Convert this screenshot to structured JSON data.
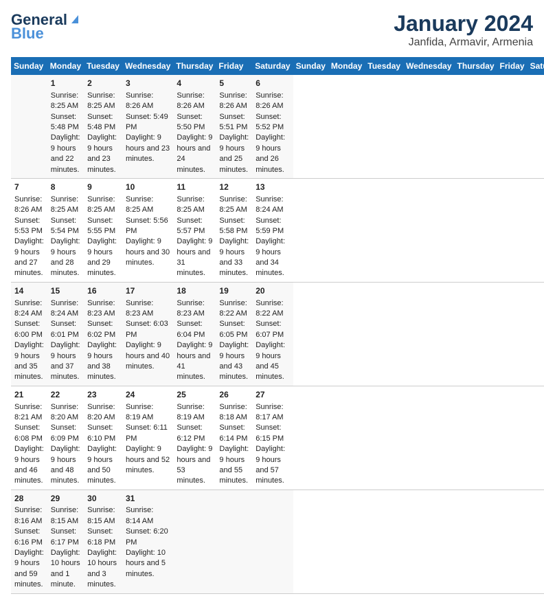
{
  "header": {
    "logo_general": "General",
    "logo_blue": "Blue",
    "title": "January 2024",
    "subtitle": "Janfida, Armavir, Armenia"
  },
  "calendar": {
    "days_of_week": [
      "Sunday",
      "Monday",
      "Tuesday",
      "Wednesday",
      "Thursday",
      "Friday",
      "Saturday"
    ],
    "weeks": [
      [
        {
          "day": "",
          "sunrise": "",
          "sunset": "",
          "daylight": ""
        },
        {
          "day": "1",
          "sunrise": "Sunrise: 8:25 AM",
          "sunset": "Sunset: 5:48 PM",
          "daylight": "Daylight: 9 hours and 22 minutes."
        },
        {
          "day": "2",
          "sunrise": "Sunrise: 8:25 AM",
          "sunset": "Sunset: 5:48 PM",
          "daylight": "Daylight: 9 hours and 23 minutes."
        },
        {
          "day": "3",
          "sunrise": "Sunrise: 8:26 AM",
          "sunset": "Sunset: 5:49 PM",
          "daylight": "Daylight: 9 hours and 23 minutes."
        },
        {
          "day": "4",
          "sunrise": "Sunrise: 8:26 AM",
          "sunset": "Sunset: 5:50 PM",
          "daylight": "Daylight: 9 hours and 24 minutes."
        },
        {
          "day": "5",
          "sunrise": "Sunrise: 8:26 AM",
          "sunset": "Sunset: 5:51 PM",
          "daylight": "Daylight: 9 hours and 25 minutes."
        },
        {
          "day": "6",
          "sunrise": "Sunrise: 8:26 AM",
          "sunset": "Sunset: 5:52 PM",
          "daylight": "Daylight: 9 hours and 26 minutes."
        }
      ],
      [
        {
          "day": "7",
          "sunrise": "Sunrise: 8:26 AM",
          "sunset": "Sunset: 5:53 PM",
          "daylight": "Daylight: 9 hours and 27 minutes."
        },
        {
          "day": "8",
          "sunrise": "Sunrise: 8:25 AM",
          "sunset": "Sunset: 5:54 PM",
          "daylight": "Daylight: 9 hours and 28 minutes."
        },
        {
          "day": "9",
          "sunrise": "Sunrise: 8:25 AM",
          "sunset": "Sunset: 5:55 PM",
          "daylight": "Daylight: 9 hours and 29 minutes."
        },
        {
          "day": "10",
          "sunrise": "Sunrise: 8:25 AM",
          "sunset": "Sunset: 5:56 PM",
          "daylight": "Daylight: 9 hours and 30 minutes."
        },
        {
          "day": "11",
          "sunrise": "Sunrise: 8:25 AM",
          "sunset": "Sunset: 5:57 PM",
          "daylight": "Daylight: 9 hours and 31 minutes."
        },
        {
          "day": "12",
          "sunrise": "Sunrise: 8:25 AM",
          "sunset": "Sunset: 5:58 PM",
          "daylight": "Daylight: 9 hours and 33 minutes."
        },
        {
          "day": "13",
          "sunrise": "Sunrise: 8:24 AM",
          "sunset": "Sunset: 5:59 PM",
          "daylight": "Daylight: 9 hours and 34 minutes."
        }
      ],
      [
        {
          "day": "14",
          "sunrise": "Sunrise: 8:24 AM",
          "sunset": "Sunset: 6:00 PM",
          "daylight": "Daylight: 9 hours and 35 minutes."
        },
        {
          "day": "15",
          "sunrise": "Sunrise: 8:24 AM",
          "sunset": "Sunset: 6:01 PM",
          "daylight": "Daylight: 9 hours and 37 minutes."
        },
        {
          "day": "16",
          "sunrise": "Sunrise: 8:23 AM",
          "sunset": "Sunset: 6:02 PM",
          "daylight": "Daylight: 9 hours and 38 minutes."
        },
        {
          "day": "17",
          "sunrise": "Sunrise: 8:23 AM",
          "sunset": "Sunset: 6:03 PM",
          "daylight": "Daylight: 9 hours and 40 minutes."
        },
        {
          "day": "18",
          "sunrise": "Sunrise: 8:23 AM",
          "sunset": "Sunset: 6:04 PM",
          "daylight": "Daylight: 9 hours and 41 minutes."
        },
        {
          "day": "19",
          "sunrise": "Sunrise: 8:22 AM",
          "sunset": "Sunset: 6:05 PM",
          "daylight": "Daylight: 9 hours and 43 minutes."
        },
        {
          "day": "20",
          "sunrise": "Sunrise: 8:22 AM",
          "sunset": "Sunset: 6:07 PM",
          "daylight": "Daylight: 9 hours and 45 minutes."
        }
      ],
      [
        {
          "day": "21",
          "sunrise": "Sunrise: 8:21 AM",
          "sunset": "Sunset: 6:08 PM",
          "daylight": "Daylight: 9 hours and 46 minutes."
        },
        {
          "day": "22",
          "sunrise": "Sunrise: 8:20 AM",
          "sunset": "Sunset: 6:09 PM",
          "daylight": "Daylight: 9 hours and 48 minutes."
        },
        {
          "day": "23",
          "sunrise": "Sunrise: 8:20 AM",
          "sunset": "Sunset: 6:10 PM",
          "daylight": "Daylight: 9 hours and 50 minutes."
        },
        {
          "day": "24",
          "sunrise": "Sunrise: 8:19 AM",
          "sunset": "Sunset: 6:11 PM",
          "daylight": "Daylight: 9 hours and 52 minutes."
        },
        {
          "day": "25",
          "sunrise": "Sunrise: 8:19 AM",
          "sunset": "Sunset: 6:12 PM",
          "daylight": "Daylight: 9 hours and 53 minutes."
        },
        {
          "day": "26",
          "sunrise": "Sunrise: 8:18 AM",
          "sunset": "Sunset: 6:14 PM",
          "daylight": "Daylight: 9 hours and 55 minutes."
        },
        {
          "day": "27",
          "sunrise": "Sunrise: 8:17 AM",
          "sunset": "Sunset: 6:15 PM",
          "daylight": "Daylight: 9 hours and 57 minutes."
        }
      ],
      [
        {
          "day": "28",
          "sunrise": "Sunrise: 8:16 AM",
          "sunset": "Sunset: 6:16 PM",
          "daylight": "Daylight: 9 hours and 59 minutes."
        },
        {
          "day": "29",
          "sunrise": "Sunrise: 8:15 AM",
          "sunset": "Sunset: 6:17 PM",
          "daylight": "Daylight: 10 hours and 1 minute."
        },
        {
          "day": "30",
          "sunrise": "Sunrise: 8:15 AM",
          "sunset": "Sunset: 6:18 PM",
          "daylight": "Daylight: 10 hours and 3 minutes."
        },
        {
          "day": "31",
          "sunrise": "Sunrise: 8:14 AM",
          "sunset": "Sunset: 6:20 PM",
          "daylight": "Daylight: 10 hours and 5 minutes."
        },
        {
          "day": "",
          "sunrise": "",
          "sunset": "",
          "daylight": ""
        },
        {
          "day": "",
          "sunrise": "",
          "sunset": "",
          "daylight": ""
        },
        {
          "day": "",
          "sunrise": "",
          "sunset": "",
          "daylight": ""
        }
      ]
    ]
  }
}
